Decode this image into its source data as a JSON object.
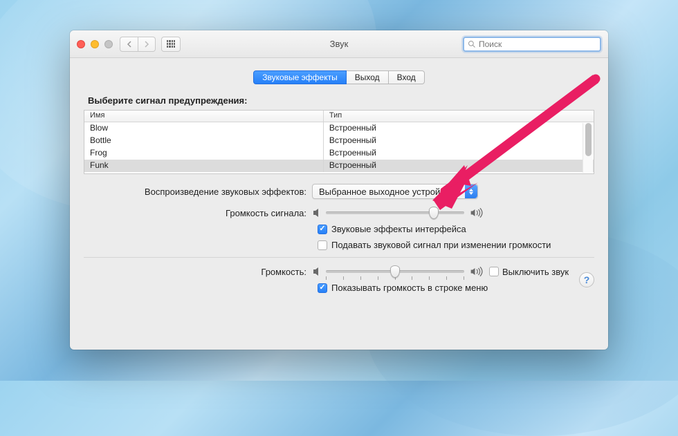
{
  "window": {
    "title": "Звук"
  },
  "search": {
    "placeholder": "Поиск"
  },
  "tabs": [
    {
      "label": "Звуковые эффекты",
      "active": true
    },
    {
      "label": "Выход",
      "active": false
    },
    {
      "label": "Вход",
      "active": false
    }
  ],
  "alerts": {
    "section_label": "Выберите сигнал предупреждения:",
    "col_name": "Имя",
    "col_type": "Тип",
    "rows": [
      {
        "name": "Blow",
        "type": "Встроенный",
        "selected": false
      },
      {
        "name": "Bottle",
        "type": "Встроенный",
        "selected": false
      },
      {
        "name": "Frog",
        "type": "Встроенный",
        "selected": false
      },
      {
        "name": "Funk",
        "type": "Встроенный",
        "selected": true
      }
    ]
  },
  "playback": {
    "label": "Воспроизведение звуковых эффектов:",
    "selected": "Выбранное выходное устройство"
  },
  "alert_volume": {
    "label": "Громкость сигнала:",
    "value": 0.78
  },
  "ui_sounds": {
    "label": "Звуковые эффекты интерфейса",
    "checked": true
  },
  "feedback_sound": {
    "label": "Подавать звуковой сигнал при изменении громкости",
    "checked": false
  },
  "output_volume": {
    "label": "Громкость:",
    "value": 0.5
  },
  "mute": {
    "label": "Выключить звук",
    "checked": false
  },
  "show_menubar": {
    "label": "Показывать громкость в строке меню",
    "checked": true
  },
  "annotation": {
    "arrow_color": "#e91e63"
  }
}
